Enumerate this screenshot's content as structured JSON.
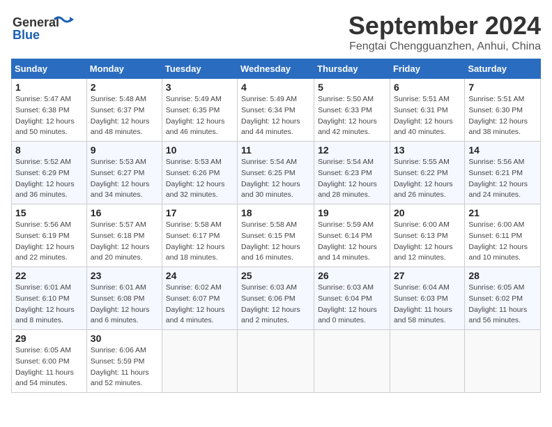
{
  "header": {
    "logo_line1": "General",
    "logo_line2": "Blue",
    "month": "September 2024",
    "location": "Fengtai Chengguanzhen, Anhui, China"
  },
  "weekdays": [
    "Sunday",
    "Monday",
    "Tuesday",
    "Wednesday",
    "Thursday",
    "Friday",
    "Saturday"
  ],
  "weeks": [
    [
      {
        "day": "1",
        "sunrise": "Sunrise: 5:47 AM",
        "sunset": "Sunset: 6:38 PM",
        "daylight": "Daylight: 12 hours and 50 minutes."
      },
      {
        "day": "2",
        "sunrise": "Sunrise: 5:48 AM",
        "sunset": "Sunset: 6:37 PM",
        "daylight": "Daylight: 12 hours and 48 minutes."
      },
      {
        "day": "3",
        "sunrise": "Sunrise: 5:49 AM",
        "sunset": "Sunset: 6:35 PM",
        "daylight": "Daylight: 12 hours and 46 minutes."
      },
      {
        "day": "4",
        "sunrise": "Sunrise: 5:49 AM",
        "sunset": "Sunset: 6:34 PM",
        "daylight": "Daylight: 12 hours and 44 minutes."
      },
      {
        "day": "5",
        "sunrise": "Sunrise: 5:50 AM",
        "sunset": "Sunset: 6:33 PM",
        "daylight": "Daylight: 12 hours and 42 minutes."
      },
      {
        "day": "6",
        "sunrise": "Sunrise: 5:51 AM",
        "sunset": "Sunset: 6:31 PM",
        "daylight": "Daylight: 12 hours and 40 minutes."
      },
      {
        "day": "7",
        "sunrise": "Sunrise: 5:51 AM",
        "sunset": "Sunset: 6:30 PM",
        "daylight": "Daylight: 12 hours and 38 minutes."
      }
    ],
    [
      {
        "day": "8",
        "sunrise": "Sunrise: 5:52 AM",
        "sunset": "Sunset: 6:29 PM",
        "daylight": "Daylight: 12 hours and 36 minutes."
      },
      {
        "day": "9",
        "sunrise": "Sunrise: 5:53 AM",
        "sunset": "Sunset: 6:27 PM",
        "daylight": "Daylight: 12 hours and 34 minutes."
      },
      {
        "day": "10",
        "sunrise": "Sunrise: 5:53 AM",
        "sunset": "Sunset: 6:26 PM",
        "daylight": "Daylight: 12 hours and 32 minutes."
      },
      {
        "day": "11",
        "sunrise": "Sunrise: 5:54 AM",
        "sunset": "Sunset: 6:25 PM",
        "daylight": "Daylight: 12 hours and 30 minutes."
      },
      {
        "day": "12",
        "sunrise": "Sunrise: 5:54 AM",
        "sunset": "Sunset: 6:23 PM",
        "daylight": "Daylight: 12 hours and 28 minutes."
      },
      {
        "day": "13",
        "sunrise": "Sunrise: 5:55 AM",
        "sunset": "Sunset: 6:22 PM",
        "daylight": "Daylight: 12 hours and 26 minutes."
      },
      {
        "day": "14",
        "sunrise": "Sunrise: 5:56 AM",
        "sunset": "Sunset: 6:21 PM",
        "daylight": "Daylight: 12 hours and 24 minutes."
      }
    ],
    [
      {
        "day": "15",
        "sunrise": "Sunrise: 5:56 AM",
        "sunset": "Sunset: 6:19 PM",
        "daylight": "Daylight: 12 hours and 22 minutes."
      },
      {
        "day": "16",
        "sunrise": "Sunrise: 5:57 AM",
        "sunset": "Sunset: 6:18 PM",
        "daylight": "Daylight: 12 hours and 20 minutes."
      },
      {
        "day": "17",
        "sunrise": "Sunrise: 5:58 AM",
        "sunset": "Sunset: 6:17 PM",
        "daylight": "Daylight: 12 hours and 18 minutes."
      },
      {
        "day": "18",
        "sunrise": "Sunrise: 5:58 AM",
        "sunset": "Sunset: 6:15 PM",
        "daylight": "Daylight: 12 hours and 16 minutes."
      },
      {
        "day": "19",
        "sunrise": "Sunrise: 5:59 AM",
        "sunset": "Sunset: 6:14 PM",
        "daylight": "Daylight: 12 hours and 14 minutes."
      },
      {
        "day": "20",
        "sunrise": "Sunrise: 6:00 AM",
        "sunset": "Sunset: 6:13 PM",
        "daylight": "Daylight: 12 hours and 12 minutes."
      },
      {
        "day": "21",
        "sunrise": "Sunrise: 6:00 AM",
        "sunset": "Sunset: 6:11 PM",
        "daylight": "Daylight: 12 hours and 10 minutes."
      }
    ],
    [
      {
        "day": "22",
        "sunrise": "Sunrise: 6:01 AM",
        "sunset": "Sunset: 6:10 PM",
        "daylight": "Daylight: 12 hours and 8 minutes."
      },
      {
        "day": "23",
        "sunrise": "Sunrise: 6:01 AM",
        "sunset": "Sunset: 6:08 PM",
        "daylight": "Daylight: 12 hours and 6 minutes."
      },
      {
        "day": "24",
        "sunrise": "Sunrise: 6:02 AM",
        "sunset": "Sunset: 6:07 PM",
        "daylight": "Daylight: 12 hours and 4 minutes."
      },
      {
        "day": "25",
        "sunrise": "Sunrise: 6:03 AM",
        "sunset": "Sunset: 6:06 PM",
        "daylight": "Daylight: 12 hours and 2 minutes."
      },
      {
        "day": "26",
        "sunrise": "Sunrise: 6:03 AM",
        "sunset": "Sunset: 6:04 PM",
        "daylight": "Daylight: 12 hours and 0 minutes."
      },
      {
        "day": "27",
        "sunrise": "Sunrise: 6:04 AM",
        "sunset": "Sunset: 6:03 PM",
        "daylight": "Daylight: 11 hours and 58 minutes."
      },
      {
        "day": "28",
        "sunrise": "Sunrise: 6:05 AM",
        "sunset": "Sunset: 6:02 PM",
        "daylight": "Daylight: 11 hours and 56 minutes."
      }
    ],
    [
      {
        "day": "29",
        "sunrise": "Sunrise: 6:05 AM",
        "sunset": "Sunset: 6:00 PM",
        "daylight": "Daylight: 11 hours and 54 minutes."
      },
      {
        "day": "30",
        "sunrise": "Sunrise: 6:06 AM",
        "sunset": "Sunset: 5:59 PM",
        "daylight": "Daylight: 11 hours and 52 minutes."
      },
      null,
      null,
      null,
      null,
      null
    ]
  ]
}
